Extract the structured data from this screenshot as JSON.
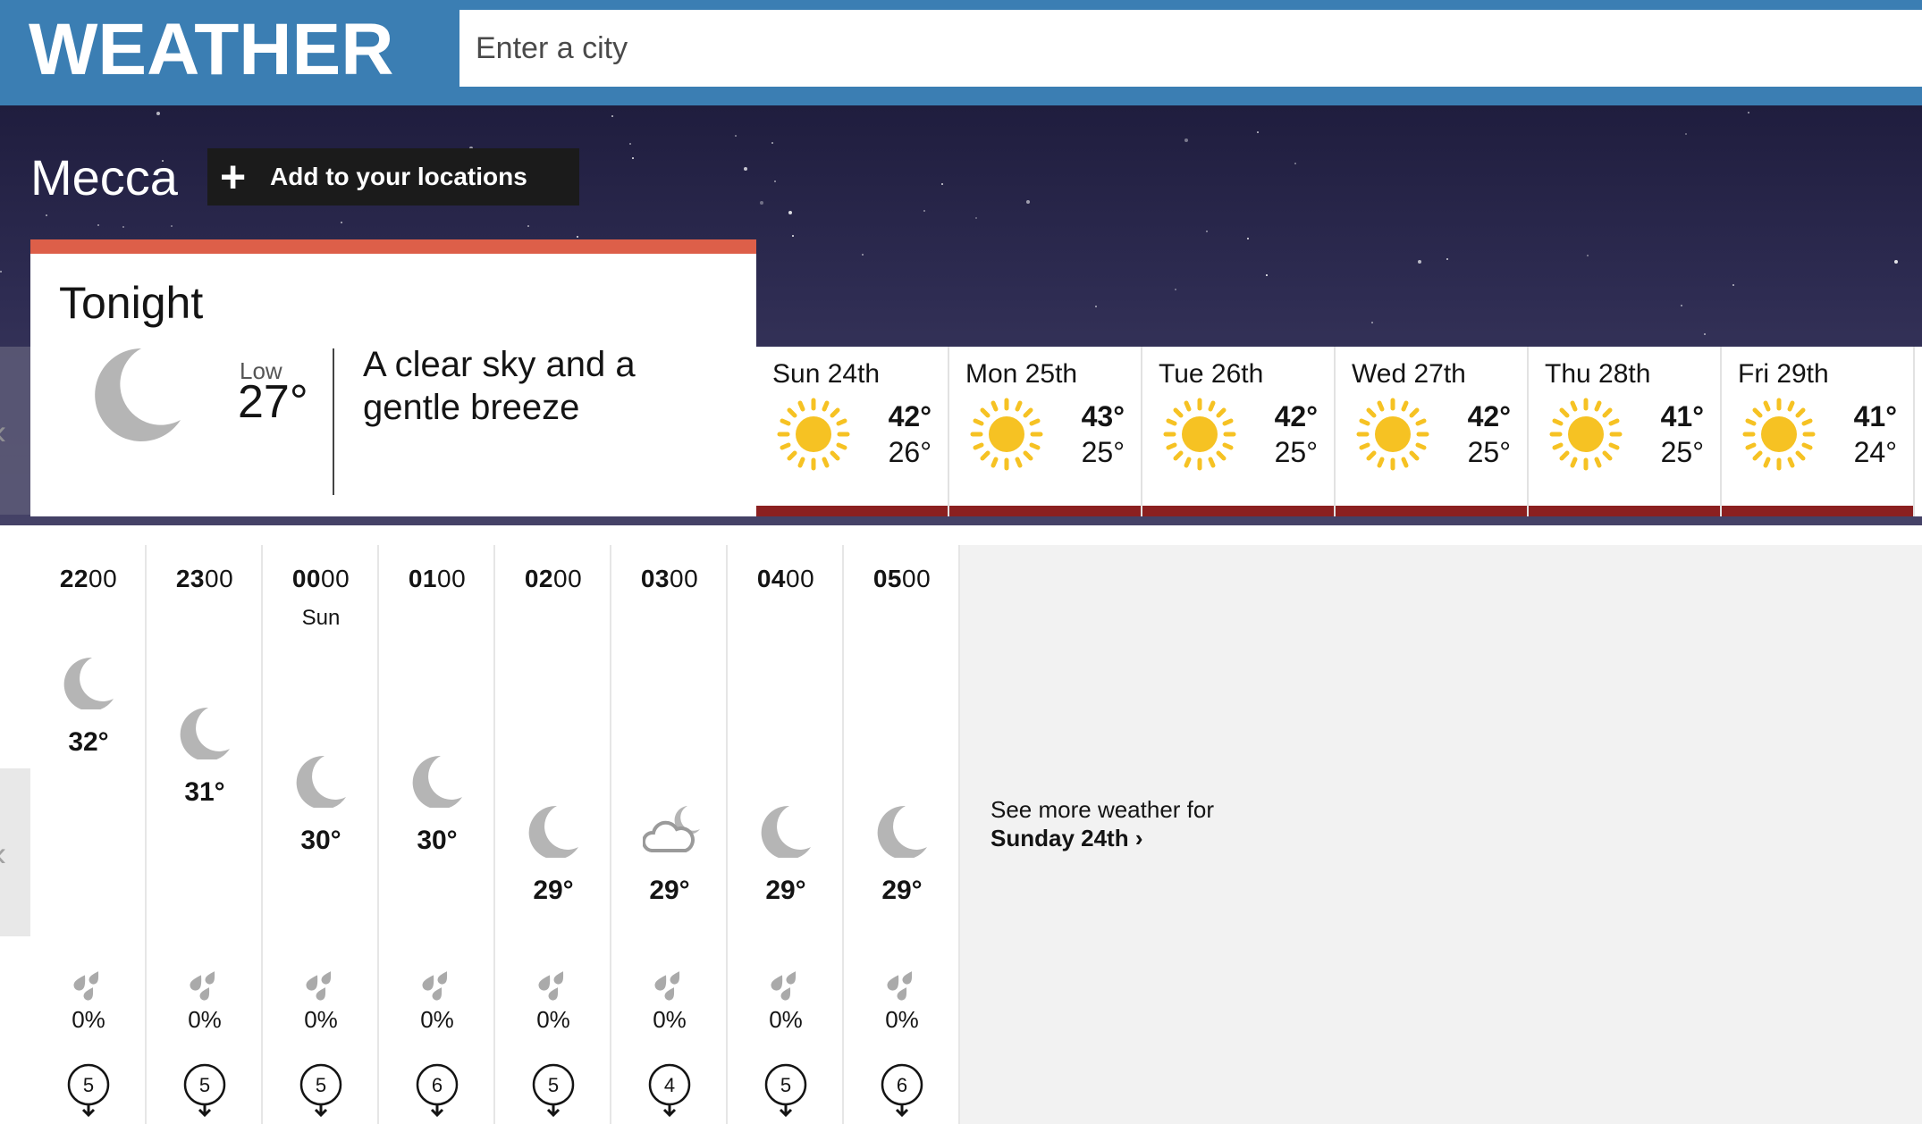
{
  "header": {
    "logo": "WEATHER",
    "search_placeholder": "Enter a city"
  },
  "location": {
    "name": "Mecca",
    "add_label": "Add to your locations"
  },
  "tonight": {
    "title": "Tonight",
    "icon": "moon-icon",
    "low_label": "Low",
    "low_value": "27°",
    "description": "A clear sky and a gentle breeze"
  },
  "days": [
    {
      "name": "Sun 24th",
      "icon": "sun-icon",
      "high": "42°",
      "low": "26°"
    },
    {
      "name": "Mon 25th",
      "icon": "sun-icon",
      "high": "43°",
      "low": "25°"
    },
    {
      "name": "Tue 26th",
      "icon": "sun-icon",
      "high": "42°",
      "low": "25°"
    },
    {
      "name": "Wed 27th",
      "icon": "sun-icon",
      "high": "42°",
      "low": "25°"
    },
    {
      "name": "Thu 28th",
      "icon": "sun-icon",
      "high": "41°",
      "low": "25°"
    },
    {
      "name": "Fri 29th",
      "icon": "sun-icon",
      "high": "41°",
      "low": "24°"
    }
  ],
  "hours": [
    {
      "time_h": "22",
      "time_m": "00",
      "day": "",
      "icon": "moon-icon",
      "temp": "32°",
      "rain": "0%",
      "wind": "5"
    },
    {
      "time_h": "23",
      "time_m": "00",
      "day": "",
      "icon": "moon-icon",
      "temp": "31°",
      "rain": "0%",
      "wind": "5"
    },
    {
      "time_h": "00",
      "time_m": "00",
      "day": "Sun",
      "icon": "moon-icon",
      "temp": "30°",
      "rain": "0%",
      "wind": "5"
    },
    {
      "time_h": "01",
      "time_m": "00",
      "day": "",
      "icon": "moon-icon",
      "temp": "30°",
      "rain": "0%",
      "wind": "6"
    },
    {
      "time_h": "02",
      "time_m": "00",
      "day": "",
      "icon": "moon-icon",
      "temp": "29°",
      "rain": "0%",
      "wind": "5"
    },
    {
      "time_h": "03",
      "time_m": "00",
      "day": "",
      "icon": "cloud-moon-icon",
      "temp": "29°",
      "rain": "0%",
      "wind": "4"
    },
    {
      "time_h": "04",
      "time_m": "00",
      "day": "",
      "icon": "moon-icon",
      "temp": "29°",
      "rain": "0%",
      "wind": "5"
    },
    {
      "time_h": "05",
      "time_m": "00",
      "day": "",
      "icon": "moon-icon",
      "temp": "29°",
      "rain": "0%",
      "wind": "6"
    }
  ],
  "more": {
    "line1": "See more weather for",
    "line2": "Sunday 24th"
  },
  "colors": {
    "header": "#3b7eb3",
    "tonight_accent": "#dd5f49",
    "day_bar": "#8b2020",
    "sun": "#f6c223",
    "moon": "#b5b5b5"
  }
}
